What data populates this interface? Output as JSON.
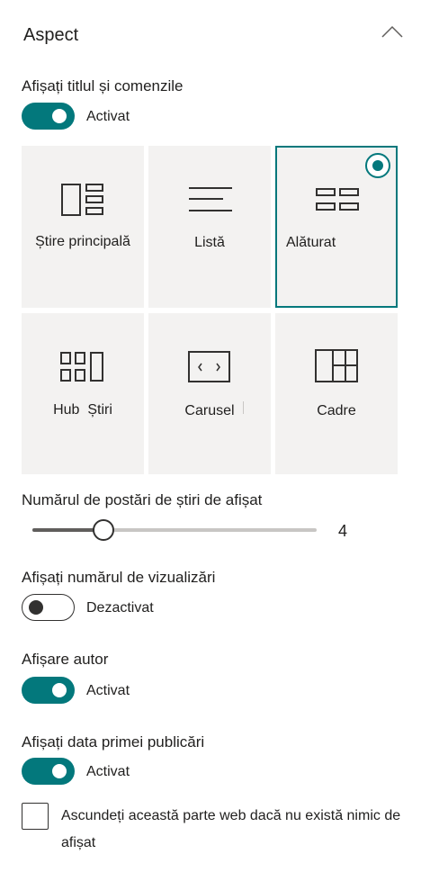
{
  "section": {
    "title": "Aspect",
    "collapse_icon": "chevron-up-icon"
  },
  "show_title": {
    "label": "Afișați titlul și comenzile",
    "state_text": "Activat",
    "on": true
  },
  "layouts": [
    {
      "label": "Știre principală",
      "icon": "top-story-icon",
      "selected": false
    },
    {
      "label": "Listă",
      "icon": "list-icon",
      "selected": false
    },
    {
      "label": "Alăturat",
      "icon": "side-by-side-icon",
      "selected": true
    },
    {
      "label": "Hub  Știri",
      "icon": "hub-news-icon",
      "selected": false
    },
    {
      "label": "Carusel",
      "icon": "carousel-icon",
      "selected": false
    },
    {
      "label": "Cadre",
      "icon": "tiles-icon",
      "selected": false
    }
  ],
  "posts_count": {
    "label": "Numărul de postări de știri de afișat",
    "value": "4",
    "min": 1,
    "max": 13
  },
  "show_views": {
    "label": "Afișați numărul de vizualizări",
    "state_text": "Dezactivat",
    "on": false
  },
  "show_author": {
    "label": "Afișare autor",
    "state_text": "Activat",
    "on": true
  },
  "show_date": {
    "label": "Afișați data primei publicări",
    "state_text": "Activat",
    "on": true
  },
  "hide_if_empty": {
    "label": "Ascundeți această parte web dacă nu există nimic de afișat",
    "checked": false
  },
  "colors": {
    "accent": "#03787c",
    "tile_bg": "#f3f2f1"
  }
}
